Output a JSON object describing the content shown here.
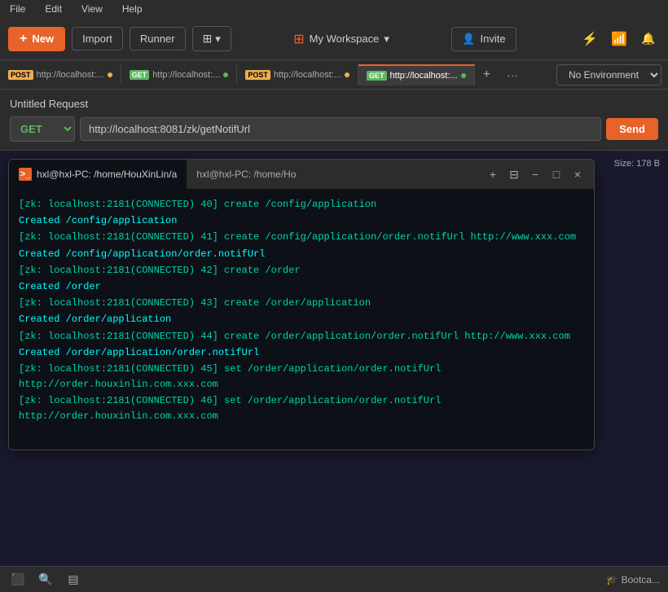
{
  "menubar": {
    "items": [
      "File",
      "Edit",
      "View",
      "Help"
    ]
  },
  "toolbar": {
    "new_label": "New",
    "import_label": "Import",
    "runner_label": "Runner",
    "workspace_label": "My Workspace",
    "invite_label": "Invite"
  },
  "tabs": [
    {
      "method": "POST",
      "url": "http://localhost:...",
      "dot_color": "orange",
      "active": false
    },
    {
      "method": "GET",
      "url": "http://localhost:...",
      "dot_color": "green",
      "active": false
    },
    {
      "method": "POST",
      "url": "http://localhost:...",
      "dot_color": "orange",
      "active": false
    },
    {
      "method": "GET",
      "url": "http://localhost:...",
      "dot_color": "green",
      "active": true
    }
  ],
  "env": {
    "label": "No Environment"
  },
  "request": {
    "title": "Untitled Request",
    "method": "GET",
    "url": "http://localhost:8081/zk/getNotifUrl",
    "send_label": "Send"
  },
  "terminal": {
    "tab1_label": "hxl@hxl-PC: /home/HouXinLin/a",
    "tab2_label": "hxl@hxl-PC: /home/Ho",
    "lines": [
      "[zk: localhost:2181(CONNECTED) 40] create /config/application",
      "Created /config/application",
      "[zk: localhost:2181(CONNECTED) 41] create /config/application/order.notifUrl http://www.xxx.com",
      "Created /config/application/order.notifUrl",
      "[zk: localhost:2181(CONNECTED) 42] create /order",
      "Created /order",
      "[zk: localhost:2181(CONNECTED) 43] create /order/application",
      "Created /order/application",
      "[zk: localhost:2181(CONNECTED) 44] create /order/application/order.notifUrl http://www.xxx.com",
      "Created /order/application/order.notifUrl",
      "[zk: localhost:2181(CONNECTED) 45] set /order/application/order.notifUrl http://order.houxinlin.com.xxx.com",
      "[zk: localhost:2181(CONNECTED) 46] set /order/application/order.notifUrl http://order.houxinlin.com.xxx.com"
    ]
  },
  "response": {
    "size_label": "Size: 178 B"
  },
  "statusbar": {
    "bootcamp_label": "Bootca..."
  },
  "icons": {
    "new": "+",
    "workspace_grid": "⊞",
    "invite_person": "👤",
    "lightning": "⚡",
    "wifi": "📶",
    "bell": "🔔",
    "close": "×",
    "minimize": "−",
    "maximize": "□",
    "plus": "+",
    "ellipsis": "···",
    "terminal_shell": ">_",
    "chevron_down": "▾",
    "search": "🔍",
    "console": "⬛",
    "panel": "▤",
    "boot": "🎓"
  }
}
